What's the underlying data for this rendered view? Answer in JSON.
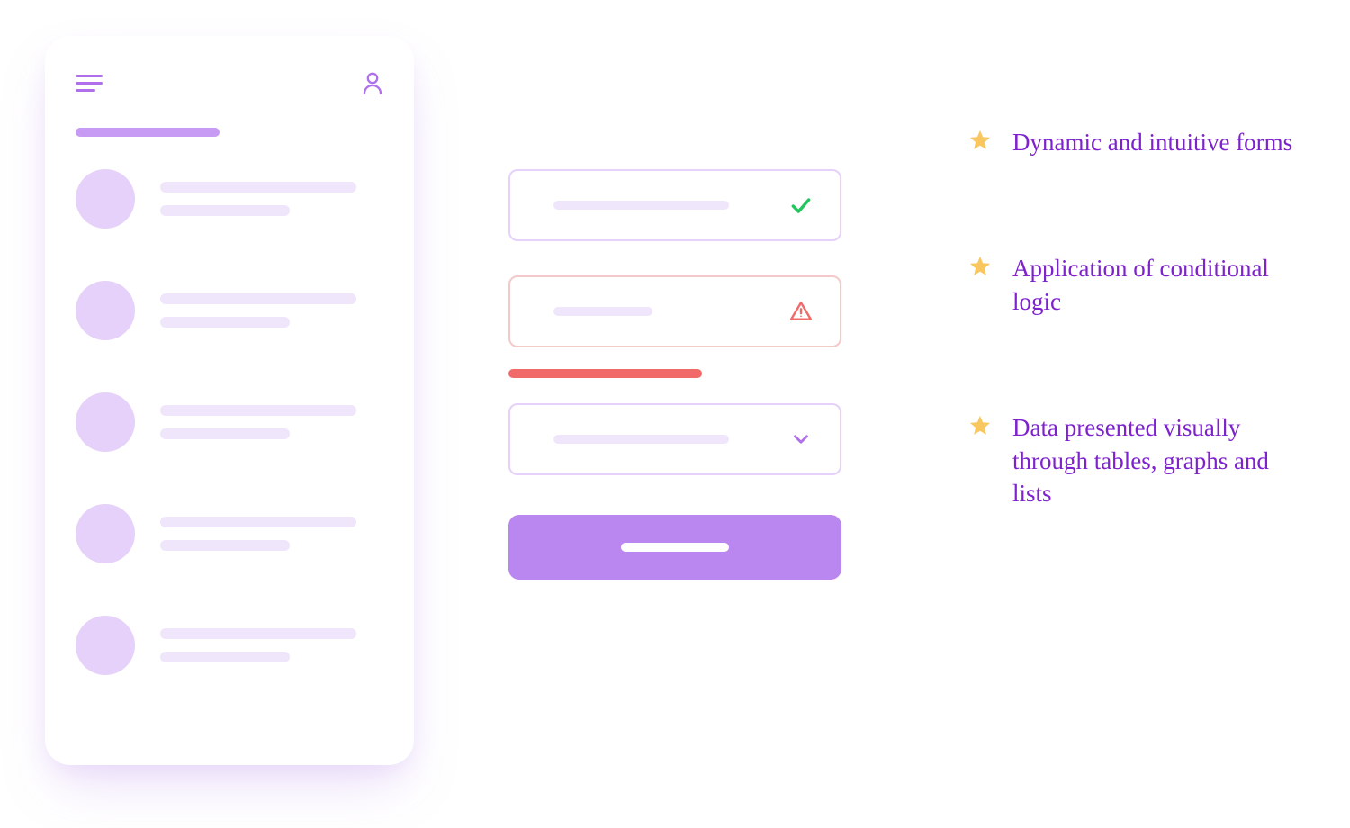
{
  "bullets": [
    {
      "text": "Dynamic and intuitive forms"
    },
    {
      "text": "Application of conditional logic"
    },
    {
      "text": "Data presented visually through tables, graphs and lists"
    }
  ],
  "colors": {
    "accent": "#b070ec",
    "purple_text": "#7e22ce",
    "error": "#f16a6a",
    "success": "#22c55e",
    "star": "#f9c760"
  },
  "icons": {
    "menu": "hamburger-icon",
    "user": "user-icon",
    "check": "check-icon",
    "warning": "warning-icon",
    "chevron_down": "chevron-down-icon",
    "star": "star-icon"
  },
  "form": {
    "fields": [
      {
        "state": "valid"
      },
      {
        "state": "error"
      },
      {
        "state": "select"
      }
    ]
  }
}
